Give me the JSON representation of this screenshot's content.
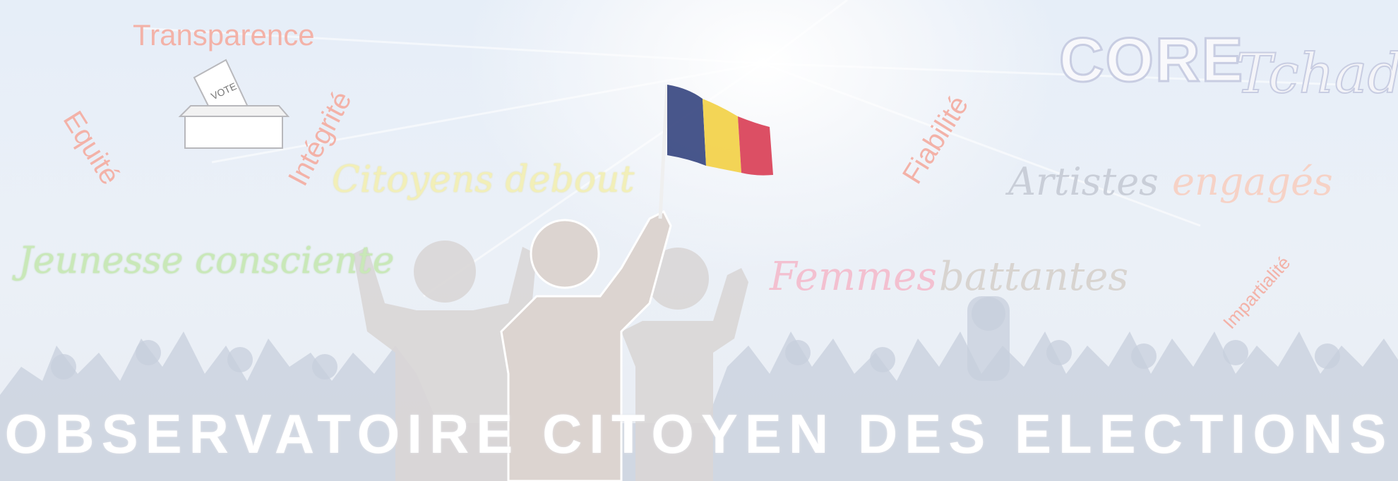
{
  "banner": {
    "title": "OBSERVATOIRE CITOYEN DES ELECTIONS",
    "logo": {
      "core": "CORE",
      "tchad": "Tchad"
    },
    "ballot_box_label": "VOTE",
    "words": {
      "transparence": "Transparence",
      "equite": "Equité",
      "integrite": "Intégrité",
      "citoyens": "Citoyens debout",
      "jeunesse": "Jeunesse consciente",
      "fiabilite": "Fiabilité",
      "artistes": "Artistes",
      "engages": "engagés",
      "femmes": "Femmes",
      "battantes": "battantes",
      "impartialite": "Impartialité"
    },
    "flag_colors": [
      "#2a3a78",
      "#f3cf3a",
      "#d8324a"
    ]
  }
}
